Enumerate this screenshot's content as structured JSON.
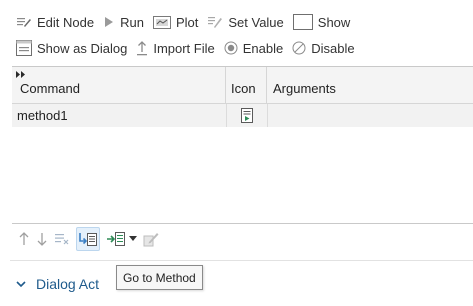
{
  "toolbar": {
    "edit_node": "Edit Node",
    "run": "Run",
    "plot": "Plot",
    "set_value": "Set Value",
    "show": "Show",
    "show_as_dialog": "Show as Dialog",
    "import_file": "Import File",
    "enable": "Enable",
    "disable": "Disable"
  },
  "table": {
    "columns": [
      "Command",
      "Icon",
      "Arguments"
    ],
    "rows": [
      {
        "command": "method1",
        "icon": "method-document-icon",
        "arguments": ""
      }
    ]
  },
  "bottom_toolbar": {
    "icons": [
      "arrow-up-icon",
      "arrow-down-icon",
      "delete-list-icon",
      "go-to-method-icon",
      "insert-method-icon",
      "chevron-down-icon",
      "edit-icon"
    ]
  },
  "tooltip": "Go to Method",
  "section": {
    "title": "Dialog Act"
  },
  "colors": {
    "accent": "#1f5b8c",
    "selection": "#e4f0fb",
    "icon_green": "#2e8b57",
    "icon_blue": "#3a7fc4"
  }
}
